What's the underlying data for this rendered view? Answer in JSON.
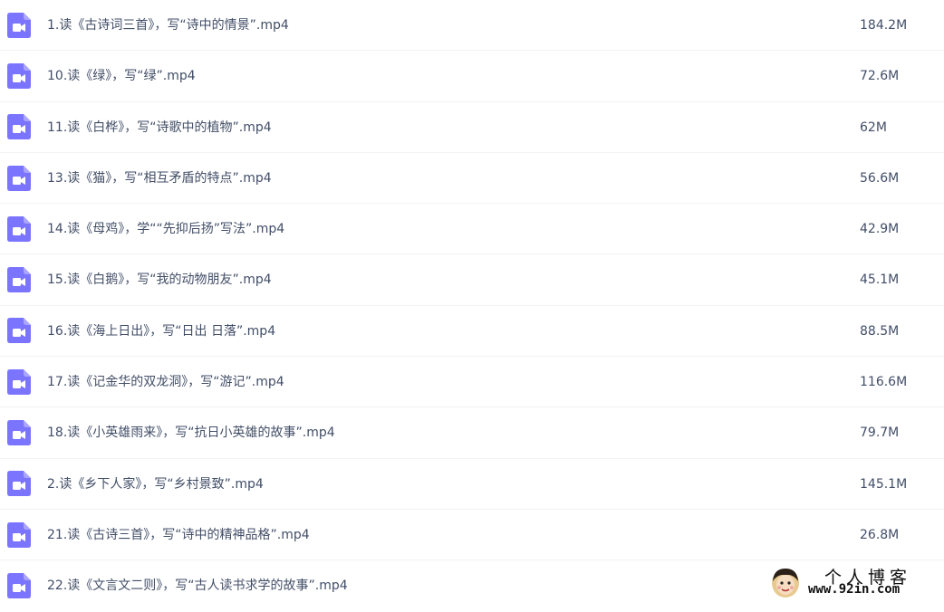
{
  "files": [
    {
      "name": "1.读《古诗词三首》，写“诗中的情景”.mp4",
      "size": "184.2M",
      "icon": "video-file-icon"
    },
    {
      "name": "10.读《绿》，写“绿”.mp4",
      "size": "72.6M",
      "icon": "video-file-icon"
    },
    {
      "name": "11.读《白桦》，写“诗歌中的植物”.mp4",
      "size": "62M",
      "icon": "video-file-icon"
    },
    {
      "name": "13.读《猫》，写“相互矛盾的特点”.mp4",
      "size": "56.6M",
      "icon": "video-file-icon"
    },
    {
      "name": "14.读《母鸡》，学““先抑后扬”写法”.mp4",
      "size": "42.9M",
      "icon": "video-file-icon"
    },
    {
      "name": "15.读《白鹅》，写“我的动物朋友”.mp4",
      "size": "45.1M",
      "icon": "video-file-icon"
    },
    {
      "name": "16.读《海上日出》，写“日出 日落”.mp4",
      "size": "88.5M",
      "icon": "video-file-icon"
    },
    {
      "name": "17.读《记金华的双龙洞》，写“游记”.mp4",
      "size": "116.6M",
      "icon": "video-file-icon"
    },
    {
      "name": "18.读《小英雄雨来》，写“抗日小英雄的故事”.mp4",
      "size": "79.7M",
      "icon": "video-file-icon"
    },
    {
      "name": "2.读《乡下人家》，写“乡村景致”.mp4",
      "size": "145.1M",
      "icon": "video-file-icon"
    },
    {
      "name": "21.读《古诗三首》，写“诗中的精神品格”.mp4",
      "size": "26.8M",
      "icon": "video-file-icon"
    },
    {
      "name": "22.读《文言文二则》，写“古人读书求学的故事”.mp4",
      "size": "",
      "icon": "video-file-icon"
    }
  ],
  "watermark": {
    "title": "个人博客",
    "url": "www.92in.com"
  },
  "colors": {
    "icon": "#7b74ff",
    "text": "#424e67",
    "divider": "#f1f2f4"
  }
}
